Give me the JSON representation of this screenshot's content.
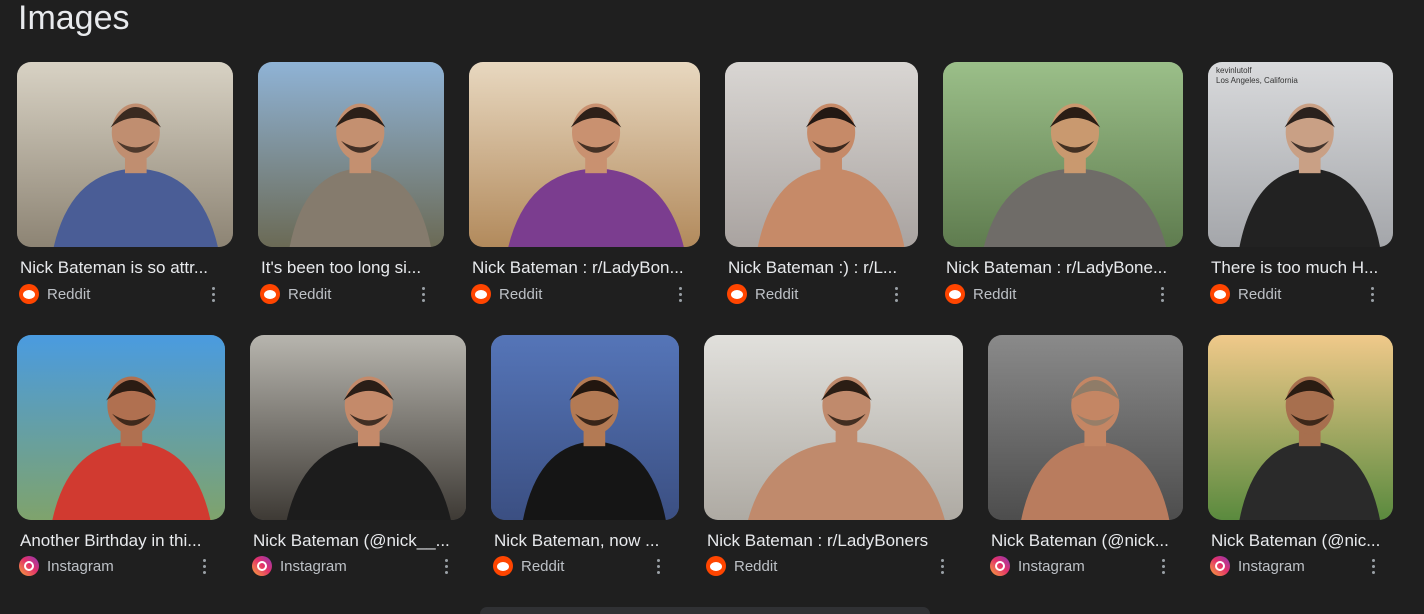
{
  "heading": "Images",
  "results": [
    {
      "title": "Nick Bateman is so attr...",
      "source": "Reddit",
      "source_icon": "reddit-icon"
    },
    {
      "title": "It's been too long si...",
      "source": "Reddit",
      "source_icon": "reddit-icon"
    },
    {
      "title": "Nick Bateman : r/LadyBon...",
      "source": "Reddit",
      "source_icon": "reddit-icon"
    },
    {
      "title": "Nick Bateman :) : r/L...",
      "source": "Reddit",
      "source_icon": "reddit-icon"
    },
    {
      "title": "Nick Bateman : r/LadyBone...",
      "source": "Reddit",
      "source_icon": "reddit-icon"
    },
    {
      "title": "There is too much H...",
      "source": "Reddit",
      "source_icon": "reddit-icon",
      "image_caption": "kevinlutolf\nLos Angeles, California"
    },
    {
      "title": "Another Birthday in thi...",
      "source": "Instagram",
      "source_icon": "instagram-icon"
    },
    {
      "title": "Nick Bateman (@nick__...",
      "source": "Instagram",
      "source_icon": "instagram-icon"
    },
    {
      "title": "Nick Bateman, now ...",
      "source": "Reddit",
      "source_icon": "reddit-icon"
    },
    {
      "title": "Nick Bateman : r/LadyBoners",
      "source": "Reddit",
      "source_icon": "reddit-icon"
    },
    {
      "title": "Nick Bateman (@nick...",
      "source": "Instagram",
      "source_icon": "instagram-icon"
    },
    {
      "title": "Nick Bateman (@nic...",
      "source": "Instagram",
      "source_icon": "instagram-icon"
    }
  ],
  "colors": {
    "background": "#1f1f1f",
    "text": "#e8eaed",
    "secondary_text": "#bdc1c6",
    "reddit": "#ff4500"
  }
}
